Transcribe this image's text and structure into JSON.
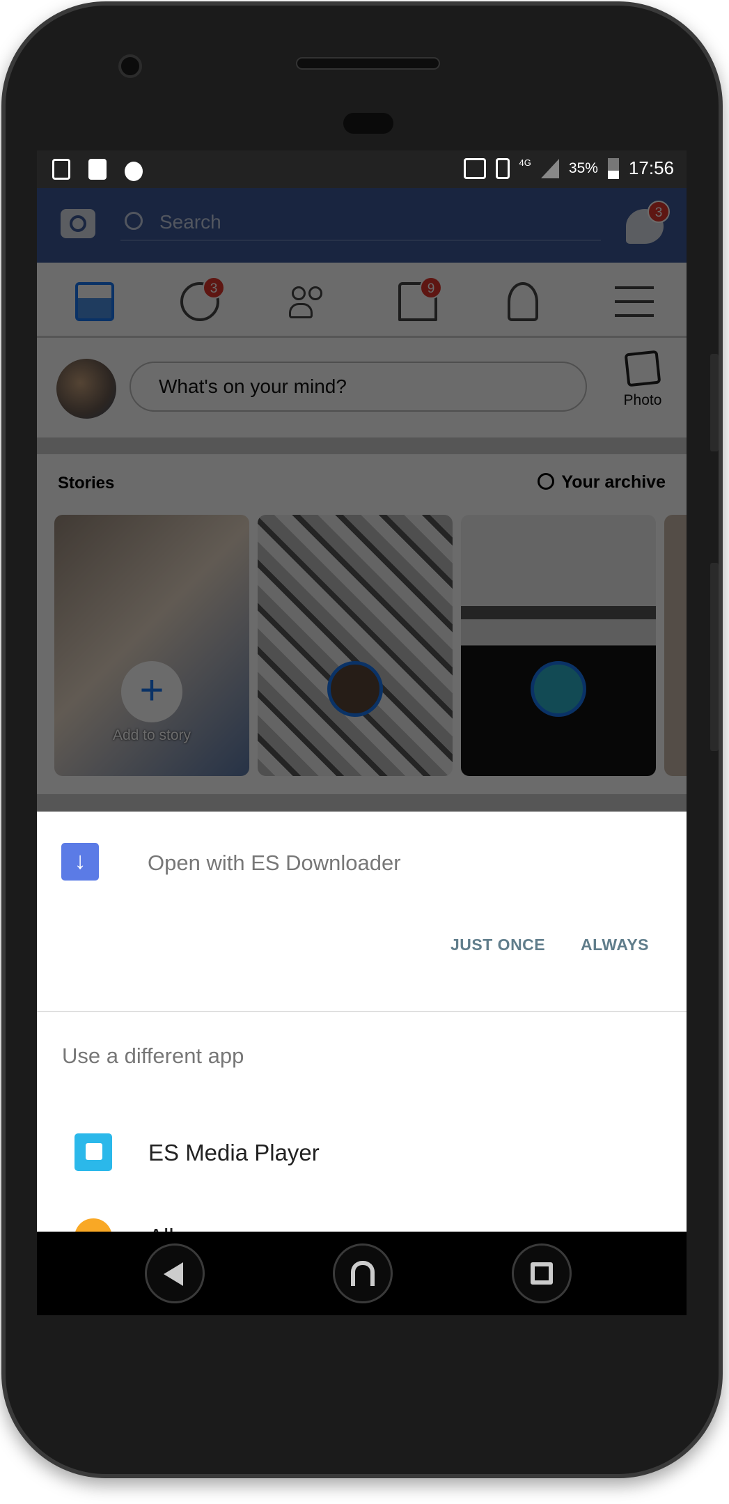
{
  "status_bar": {
    "network": "4G",
    "battery": "35%",
    "time": "17:56"
  },
  "facebook": {
    "search_placeholder": "Search",
    "messenger_badge": "3",
    "nav": [
      {
        "name": "news-feed"
      },
      {
        "name": "groups",
        "badge": "3"
      },
      {
        "name": "friends"
      },
      {
        "name": "marketplace",
        "badge": "9"
      },
      {
        "name": "notifications"
      },
      {
        "name": "menu"
      }
    ],
    "composer_placeholder": "What's on your mind?",
    "photo_label": "Photo",
    "stories_title": "Stories",
    "archive_label": "Your archive",
    "add_to_story": "Add to story"
  },
  "chooser": {
    "title": "Open with ES Downloader",
    "just_once": "JUST ONCE",
    "always": "ALWAYS",
    "different_app": "Use a different app",
    "apps": [
      {
        "label": "ES Media Player",
        "color": "#2bb8ea"
      },
      {
        "label": "Album",
        "color": "#f9a825"
      }
    ]
  },
  "colors": {
    "facebook_blue": "#3b5998",
    "button_text": "#607d8b",
    "badge": "#e0352b"
  }
}
